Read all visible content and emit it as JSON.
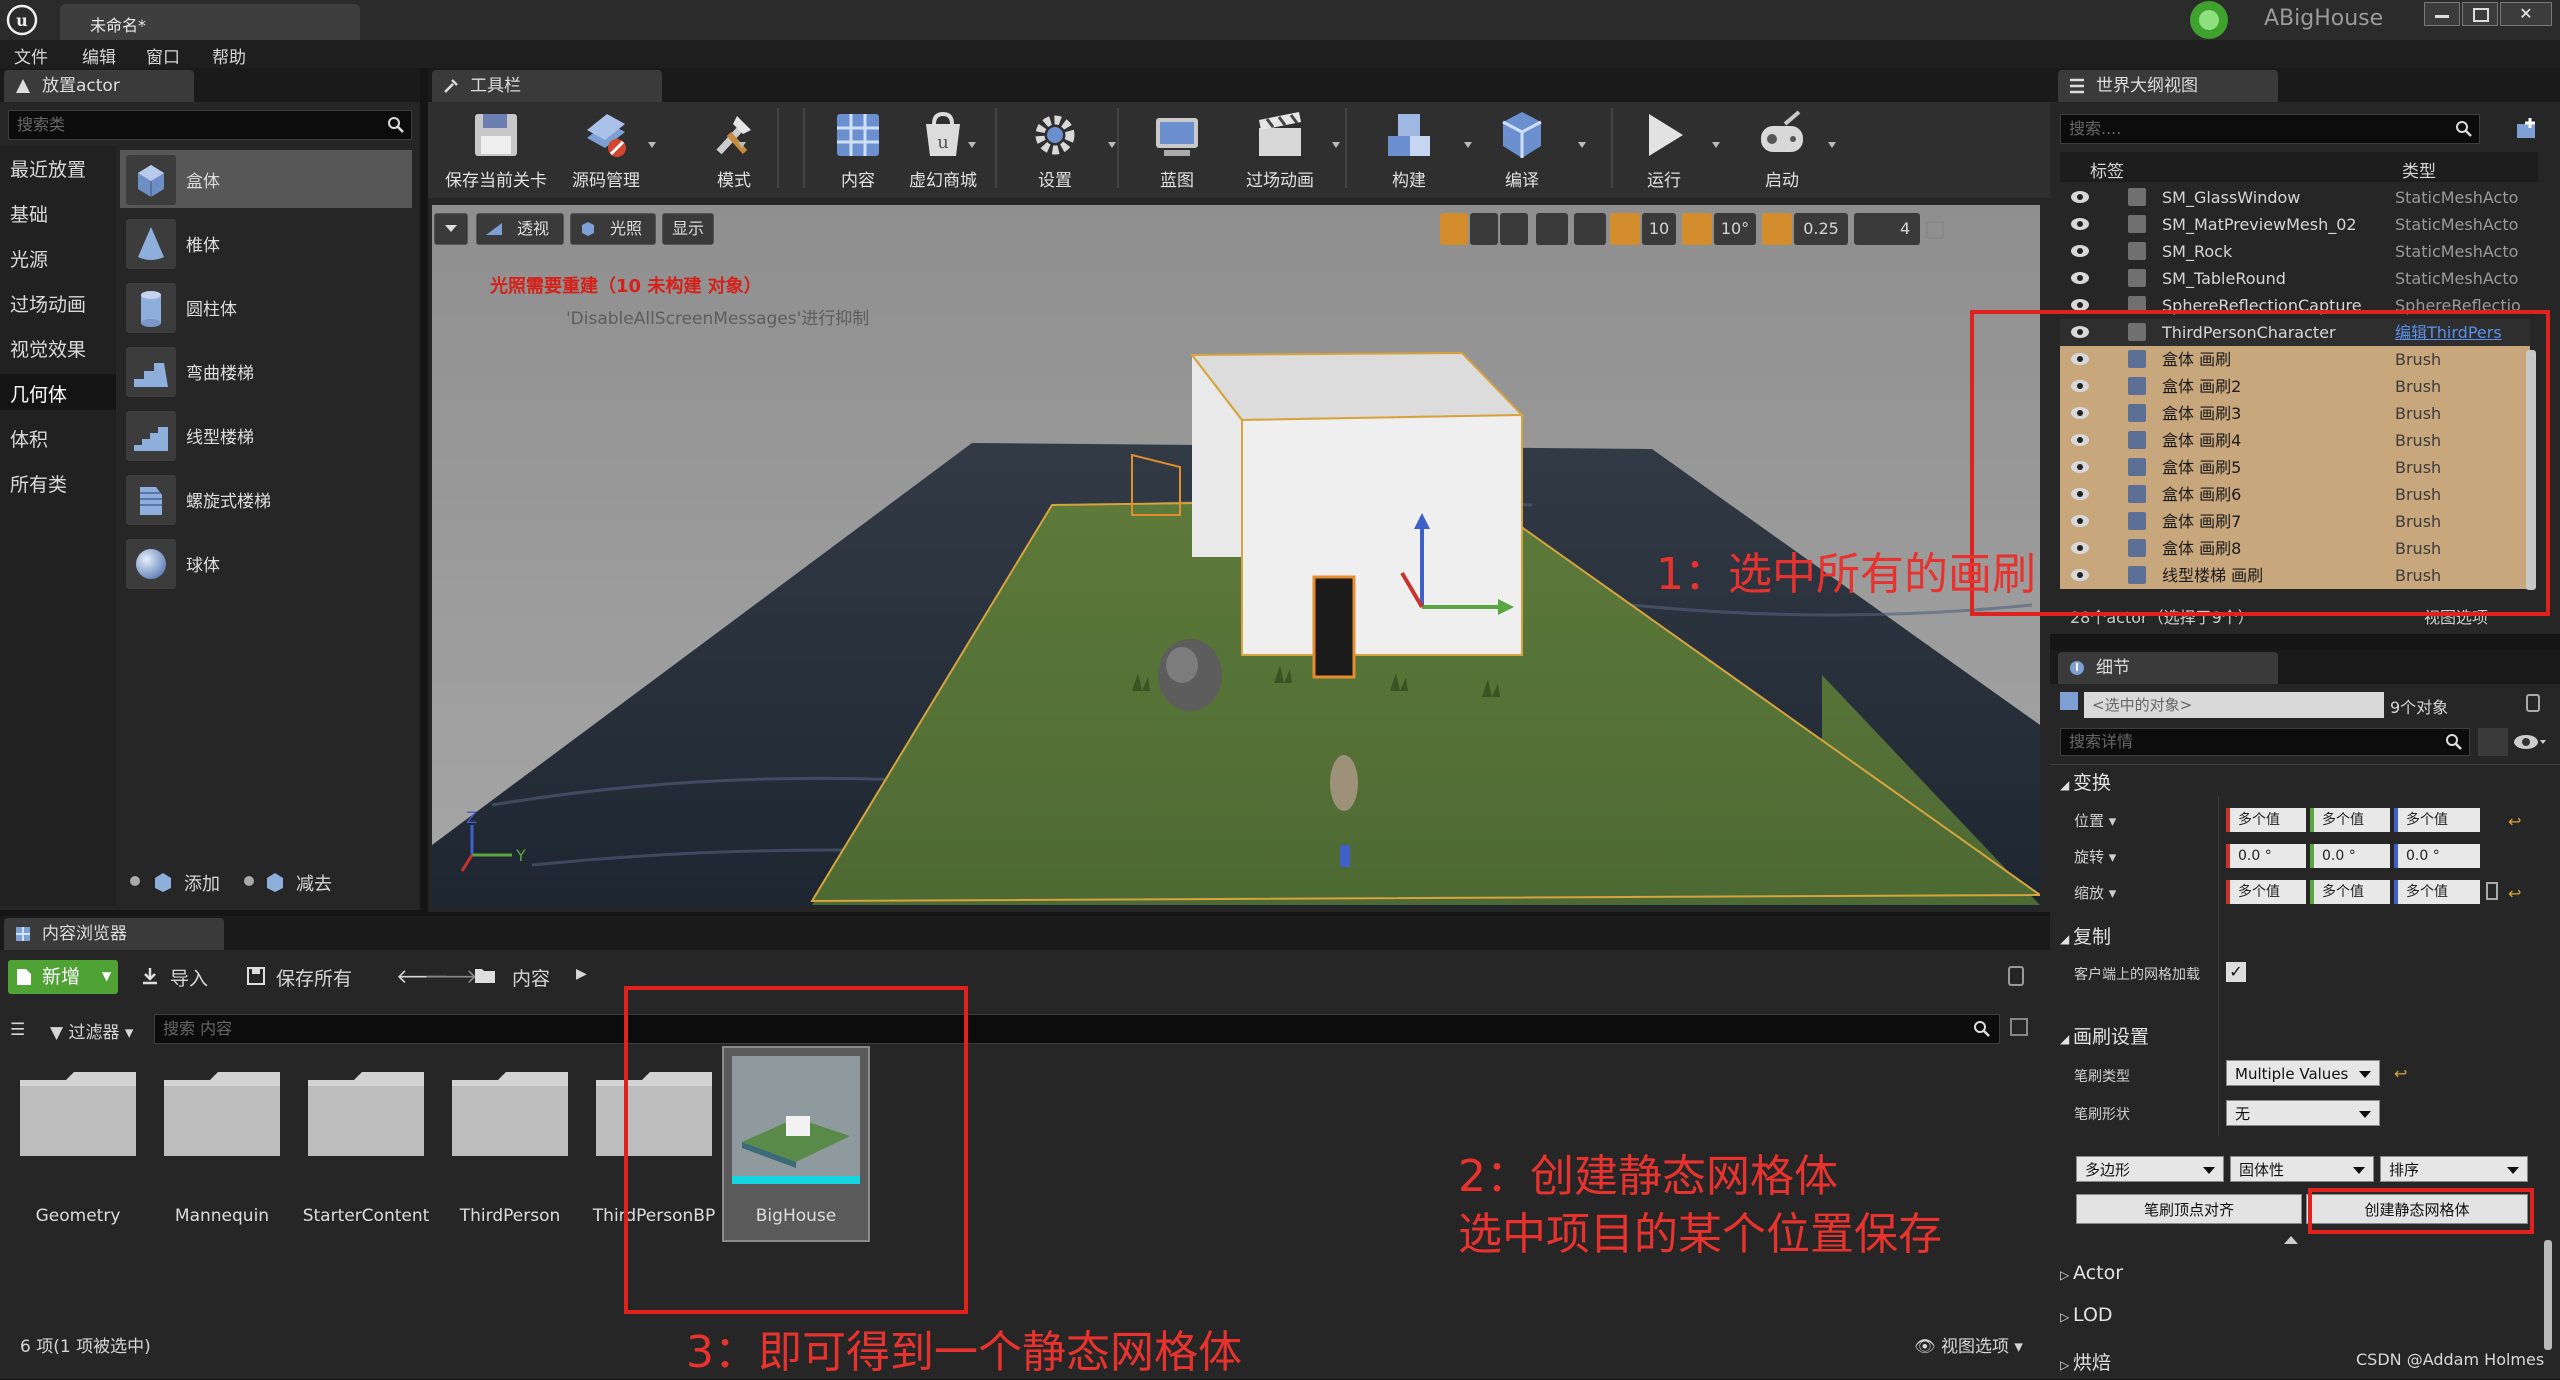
{
  "titlebar": {
    "doc_tab": "未命名*",
    "project": "ABigHouse"
  },
  "menu": [
    "文件",
    "编辑",
    "窗口",
    "帮助"
  ],
  "place_actors": {
    "tab": "放置actor",
    "search_placeholder": "搜索类",
    "categories": [
      "最近放置",
      "基础",
      "光源",
      "过场动画",
      "视觉效果",
      "几何体",
      "体积",
      "所有类"
    ],
    "selected_category": "几何体",
    "items": [
      "盒体",
      "椎体",
      "圆柱体",
      "弯曲楼梯",
      "线型楼梯",
      "螺旋式楼梯",
      "球体"
    ],
    "add_label": "添加",
    "subtract_label": "减去"
  },
  "toolbar": {
    "tab": "工具栏",
    "buttons": [
      "保存当前关卡",
      "源码管理",
      "模式",
      "内容",
      "虚幻商城",
      "设置",
      "蓝图",
      "过场动画",
      "构建",
      "编译",
      "运行",
      "启动"
    ]
  },
  "viewport": {
    "perspective": "透视",
    "lit": "光照",
    "show": "显示",
    "grid_snap": "10",
    "rot_snap": "10°",
    "scale_snap": "0.25",
    "cam_speed": "4",
    "warning_title": "光照需要重建（10 未构建 对象）",
    "warning_sub": "'DisableAllScreenMessages'进行抑制",
    "axis_z": "Z",
    "axis_y": "Y"
  },
  "outliner": {
    "tab": "世界大纲视图",
    "search_placeholder": "搜索....",
    "col_label": "标签",
    "col_type": "类型",
    "rows": [
      {
        "name": "SM_GlassWindow",
        "type": "StaticMeshActo",
        "selected": false
      },
      {
        "name": "SM_MatPreviewMesh_02",
        "type": "StaticMeshActo",
        "selected": false
      },
      {
        "name": "SM_Rock",
        "type": "StaticMeshActo",
        "selected": false
      },
      {
        "name": "SM_TableRound",
        "type": "StaticMeshActo",
        "selected": false
      },
      {
        "name": "SphereReflectionCapture",
        "type": "SphereReflectio",
        "selected": false
      },
      {
        "name": "ThirdPersonCharacter",
        "type": "编辑ThirdPers",
        "selected": false
      },
      {
        "name": "盒体 画刷",
        "type": "Brush",
        "selected": true
      },
      {
        "name": "盒体 画刷2",
        "type": "Brush",
        "selected": true
      },
      {
        "name": "盒体 画刷3",
        "type": "Brush",
        "selected": true
      },
      {
        "name": "盒体 画刷4",
        "type": "Brush",
        "selected": true
      },
      {
        "name": "盒体 画刷5",
        "type": "Brush",
        "selected": true
      },
      {
        "name": "盒体 画刷6",
        "type": "Brush",
        "selected": true
      },
      {
        "name": "盒体 画刷7",
        "type": "Brush",
        "selected": true
      },
      {
        "name": "盒体 画刷8",
        "type": "Brush",
        "selected": true
      },
      {
        "name": "线型楼梯 画刷",
        "type": "Brush",
        "selected": true
      }
    ],
    "footer": "28个actor（选择了9个）",
    "view_options": "视图选项"
  },
  "details": {
    "tab": "细节",
    "selected_objects": "<选中的对象>",
    "object_count": "9个对象",
    "search_placeholder": "搜索详情",
    "transform_section": "变换",
    "location_label": "位置",
    "rotation_label": "旋转",
    "scale_label": "缩放",
    "multi_value": "多个值",
    "rot_value": "0.0 °",
    "replication_section": "复制",
    "client_mesh_label": "客户端上的网格加载",
    "brush_section": "画刷设置",
    "brush_type_label": "笔刷类型",
    "brush_type_value": "Multiple Values",
    "brush_shape_label": "笔刷形状",
    "brush_shape_value": "无",
    "polygon": "多边形",
    "solidity": "固体性",
    "order": "排序",
    "align_vertices": "笔刷顶点对齐",
    "create_static_mesh": "创建静态网格体",
    "actor_section": "Actor",
    "lod_section": "LOD",
    "cooking_section": "烘焙"
  },
  "content_browser": {
    "tab": "内容浏览器",
    "new_button": "新增",
    "import_button": "导入",
    "save_all_button": "保存所有",
    "path": "内容",
    "filters": "过滤器",
    "search_placeholder": "搜索 内容",
    "items": [
      "Geometry",
      "Mannequin",
      "StarterContent",
      "ThirdPerson",
      "ThirdPersonBP",
      "BigHouse"
    ],
    "status": "6 项(1 项被选中)",
    "view_options": "视图选项"
  },
  "annotations": {
    "step1": "1：选中所有的画刷",
    "step2_line1": "2：创建静态网格体",
    "step2_line2": "选中项目的某个位置保存",
    "step3": "3：即可得到一个静态网格体",
    "watermark": "CSDN @Addam Holmes"
  },
  "colors": {
    "accent_red": "#e8322e",
    "selected_row": "#c9a77c",
    "new_button": "#4fa334",
    "x_axis": "#c8342c",
    "y_axis": "#5aa640",
    "z_axis": "#3f5fc9"
  }
}
